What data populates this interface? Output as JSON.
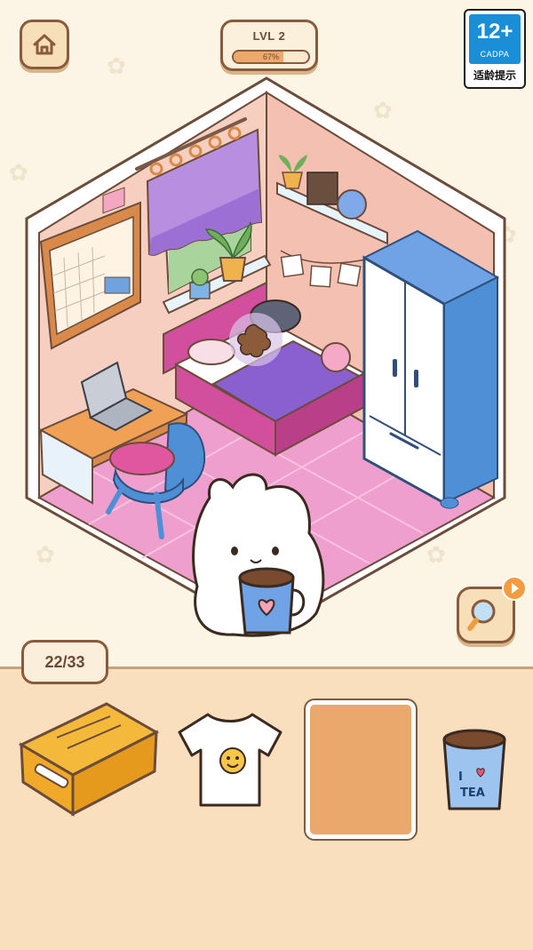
{
  "header": {
    "level_label": "LVL 2",
    "progress_text": "67%",
    "progress_fraction": 0.67
  },
  "age_rating": {
    "rating": "12+",
    "org": "CADPA",
    "note": "适龄提示"
  },
  "counter": {
    "found_text": "22/33"
  },
  "tray": {
    "items": [
      {
        "name": "suitcase-item",
        "state": "hidden-object"
      },
      {
        "name": "tshirt-item",
        "state": "hidden-object"
      },
      {
        "name": "cork-board-item",
        "state": "hidden-object"
      },
      {
        "name": "tea-cup-item",
        "state": "hidden-object",
        "label": "I ♥ TEA"
      }
    ]
  },
  "tea_cup_label_top": "I",
  "tea_cup_label_bottom": "TEA",
  "colors": {
    "background": "#fcf4e4",
    "accent_brown": "#8a5a3c",
    "tray": "#fadfbf",
    "progress_fill": "#eca96b",
    "rating_blue": "#1a8fd8",
    "wall_pink": "#f6cfc0",
    "floor_pink": "#ef9fcd",
    "wardrobe_blue": "#4f8fd6"
  }
}
